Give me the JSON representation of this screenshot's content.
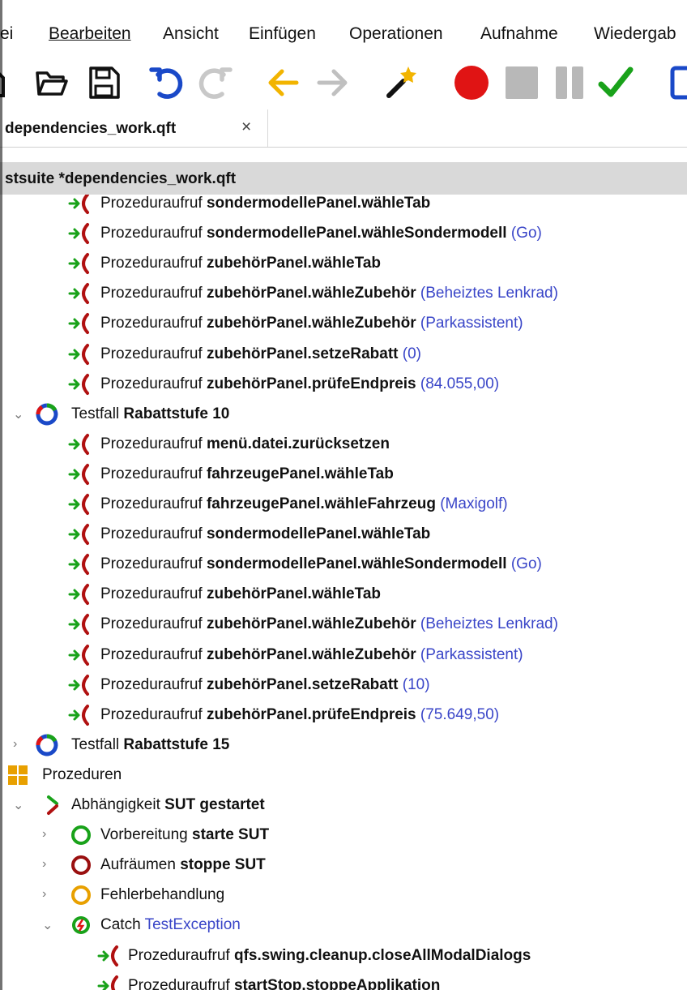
{
  "menu": [
    "ei",
    "Bearbeiten",
    "Ansicht",
    "Einfügen",
    "Operationen",
    "Aufnahme",
    "Wiedergab"
  ],
  "toolbar": {
    "icons": [
      "open-folder-icon",
      "save-icon",
      "undo-icon",
      "redo-icon",
      "back-arrow-icon",
      "forward-arrow-icon",
      "magic-wand-icon",
      "record-icon",
      "stop-icon",
      "pause-icon",
      "check-icon"
    ],
    "colors": {
      "undo": "#1a49c8",
      "arrow": "#f2b400",
      "record": "#e01414",
      "check": "#19a21a",
      "disabled": "#b8b8b8"
    }
  },
  "tab": {
    "label": "dependencies_work.qft",
    "close": "×"
  },
  "tree": {
    "header": "stsuite *dependencies_work.qft",
    "rows": [
      {
        "kind": "call",
        "t": "Prozeduraufruf ",
        "b": "sondermodellePanel.wähleTab",
        "p": ""
      },
      {
        "kind": "call",
        "t": "Prozeduraufruf ",
        "b": "sondermodellePanel.wähleSondermodell",
        "p": "(Go)"
      },
      {
        "kind": "call",
        "t": "Prozeduraufruf ",
        "b": "zubehörPanel.wähleTab",
        "p": ""
      },
      {
        "kind": "call",
        "t": "Prozeduraufruf ",
        "b": "zubehörPanel.wähleZubehör",
        "p": "(Beheiztes Lenkrad)"
      },
      {
        "kind": "call",
        "t": "Prozeduraufruf ",
        "b": "zubehörPanel.wähleZubehör",
        "p": "(Parkassistent)"
      },
      {
        "kind": "call",
        "t": "Prozeduraufruf ",
        "b": "zubehörPanel.setzeRabatt",
        "p": "(0)"
      },
      {
        "kind": "call",
        "t": "Prozeduraufruf ",
        "b": "zubehörPanel.prüfeEndpreis",
        "p": "(84.055,00)"
      },
      {
        "kind": "testcase",
        "exp": "⌄",
        "t": "Testfall ",
        "b": "Rabattstufe 10",
        "p": ""
      },
      {
        "kind": "call",
        "t": "Prozeduraufruf ",
        "b": "menü.datei.zurücksetzen",
        "p": ""
      },
      {
        "kind": "call",
        "t": "Prozeduraufruf ",
        "b": "fahrzeugePanel.wähleTab",
        "p": ""
      },
      {
        "kind": "call",
        "t": "Prozeduraufruf ",
        "b": "fahrzeugePanel.wähleFahrzeug",
        "p": "(Maxigolf)"
      },
      {
        "kind": "call",
        "t": "Prozeduraufruf ",
        "b": "sondermodellePanel.wähleTab",
        "p": ""
      },
      {
        "kind": "call",
        "t": "Prozeduraufruf ",
        "b": "sondermodellePanel.wähleSondermodell",
        "p": "(Go)"
      },
      {
        "kind": "call",
        "t": "Prozeduraufruf ",
        "b": "zubehörPanel.wähleTab",
        "p": ""
      },
      {
        "kind": "call",
        "t": "Prozeduraufruf ",
        "b": "zubehörPanel.wähleZubehör",
        "p": "(Beheiztes Lenkrad)"
      },
      {
        "kind": "call",
        "t": "Prozeduraufruf ",
        "b": "zubehörPanel.wähleZubehör",
        "p": "(Parkassistent)"
      },
      {
        "kind": "call",
        "t": "Prozeduraufruf ",
        "b": "zubehörPanel.setzeRabatt",
        "p": "(10)"
      },
      {
        "kind": "call",
        "t": "Prozeduraufruf ",
        "b": "zubehörPanel.prüfeEndpreis",
        "p": "(75.649,50)"
      },
      {
        "kind": "testcase",
        "exp": "›",
        "t": "Testfall ",
        "b": "Rabattstufe 15",
        "p": ""
      },
      {
        "kind": "procedures",
        "exp": "",
        "t": "Prozeduren",
        "b": "",
        "p": ""
      },
      {
        "kind": "dependency",
        "exp": "⌄",
        "t": "Abhängigkeit ",
        "b": "SUT gestartet",
        "p": ""
      },
      {
        "kind": "setup",
        "exp": "›",
        "t": "Vorbereitung ",
        "b": "starte SUT",
        "p": ""
      },
      {
        "kind": "cleanup",
        "exp": "›",
        "t": "Aufräumen ",
        "b": "stoppe SUT",
        "p": ""
      },
      {
        "kind": "errorhandler",
        "exp": "›",
        "t": "Fehlerbehandlung",
        "b": "",
        "p": ""
      },
      {
        "kind": "catch",
        "exp": "⌄",
        "t": "Catch ",
        "b": "",
        "p": "TestException"
      },
      {
        "kind": "call2",
        "t": "Prozeduraufruf ",
        "b": "qfs.swing.cleanup.closeAllModalDialogs",
        "p": ""
      },
      {
        "kind": "call2",
        "t": "Prozeduraufruf ",
        "b": "startStop.stoppeApplikation",
        "p": ""
      }
    ]
  }
}
